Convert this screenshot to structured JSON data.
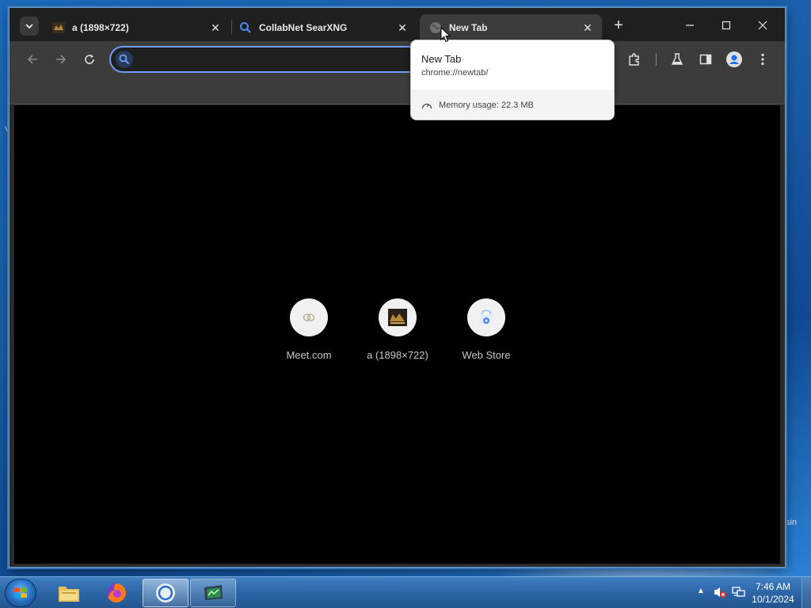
{
  "browser": {
    "tabs": [
      {
        "title": "a (1898×722)",
        "active": false,
        "favicon": "image-thumbnail-icon"
      },
      {
        "title": "CollabNet SearXNG",
        "active": false,
        "favicon": "search-icon"
      },
      {
        "title": "New Tab",
        "active": true,
        "favicon": "globe-icon"
      }
    ],
    "omnibox": {
      "value": "",
      "placeholder": ""
    }
  },
  "hovercard": {
    "title": "New Tab",
    "url": "chrome://newtab/",
    "memory": "Memory usage: 22.3 MB"
  },
  "shortcuts": [
    {
      "label": "Meet.com",
      "icon": "meet-icon"
    },
    {
      "label": "a (1898×722)",
      "icon": "image-thumbnail-icon"
    },
    {
      "label": "Web Store",
      "icon": "web-store-icon"
    }
  ],
  "desktop_fragments": {
    "right": "sin"
  },
  "taskbar": {
    "time": "7:46 AM",
    "date": "10/1/2024"
  },
  "colors": {
    "accent": "#6c9ef8",
    "content_bg": "#000000",
    "tab_active": "#3c3c3c"
  }
}
